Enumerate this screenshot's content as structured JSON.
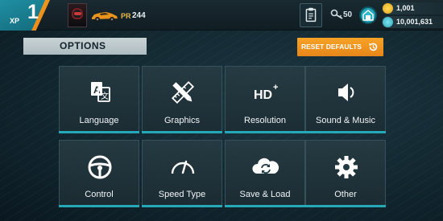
{
  "topbar": {
    "xp_level": "1",
    "xp_label": "XP",
    "pr_label": "PR",
    "pr_value": "244",
    "keys": "50",
    "coins": "1,001",
    "credits": "10,001,631"
  },
  "options": {
    "title": "OPTIONS",
    "reset_label": "RESET DEFAULTS"
  },
  "tiles": [
    {
      "label": "Language",
      "icon": "language-icon"
    },
    {
      "label": "Graphics",
      "icon": "graphics-icon"
    },
    {
      "label": "Resolution",
      "icon": "hd-icon"
    },
    {
      "label": "Sound & Music",
      "icon": "speaker-icon"
    },
    {
      "label": "Control",
      "icon": "steering-wheel-icon"
    },
    {
      "label": "Speed Type",
      "icon": "speedometer-icon"
    },
    {
      "label": "Save & Load",
      "icon": "cloud-sync-icon"
    },
    {
      "label": "Other",
      "icon": "gear-icon"
    }
  ],
  "colors": {
    "accent_orange": "#f5a623",
    "accent_teal": "#25a9b8",
    "background": "#142a33"
  }
}
